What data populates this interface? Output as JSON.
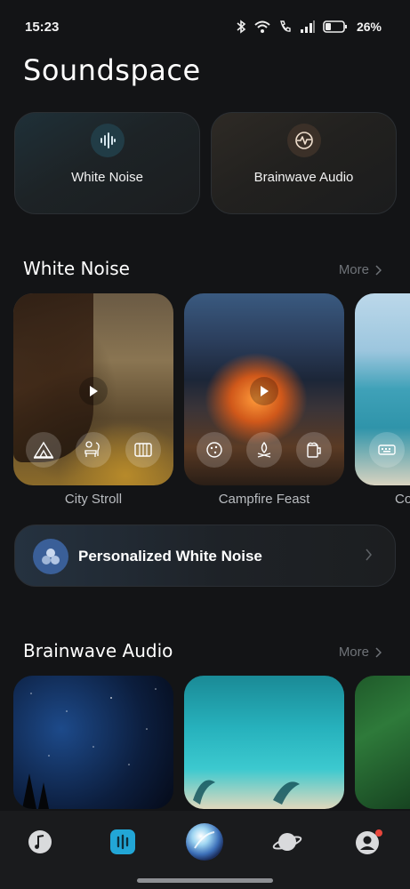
{
  "status_bar": {
    "time": "15:23",
    "battery": "26%"
  },
  "app_title": "Soundspace",
  "top_cards": [
    {
      "label": "White Noise",
      "icon": "waveform-icon"
    },
    {
      "label": "Brainwave Audio",
      "icon": "brainwave-icon"
    }
  ],
  "white_noise_section": {
    "title": "White Noise",
    "more": "More",
    "tiles": [
      {
        "caption": "City Stroll"
      },
      {
        "caption": "Campfire Feast"
      },
      {
        "caption": "Co"
      }
    ]
  },
  "personalized": {
    "label": "Personalized White Noise"
  },
  "brainwave_section": {
    "title": "Brainwave Audio",
    "more": "More"
  },
  "bottom_nav": [
    "music-note-icon",
    "soundspace-icon",
    "orb-icon",
    "planet-icon",
    "profile-icon"
  ],
  "colors": {
    "background": "#131416",
    "accent_blue": "#22a6d6",
    "notification_red": "#e8463c"
  }
}
